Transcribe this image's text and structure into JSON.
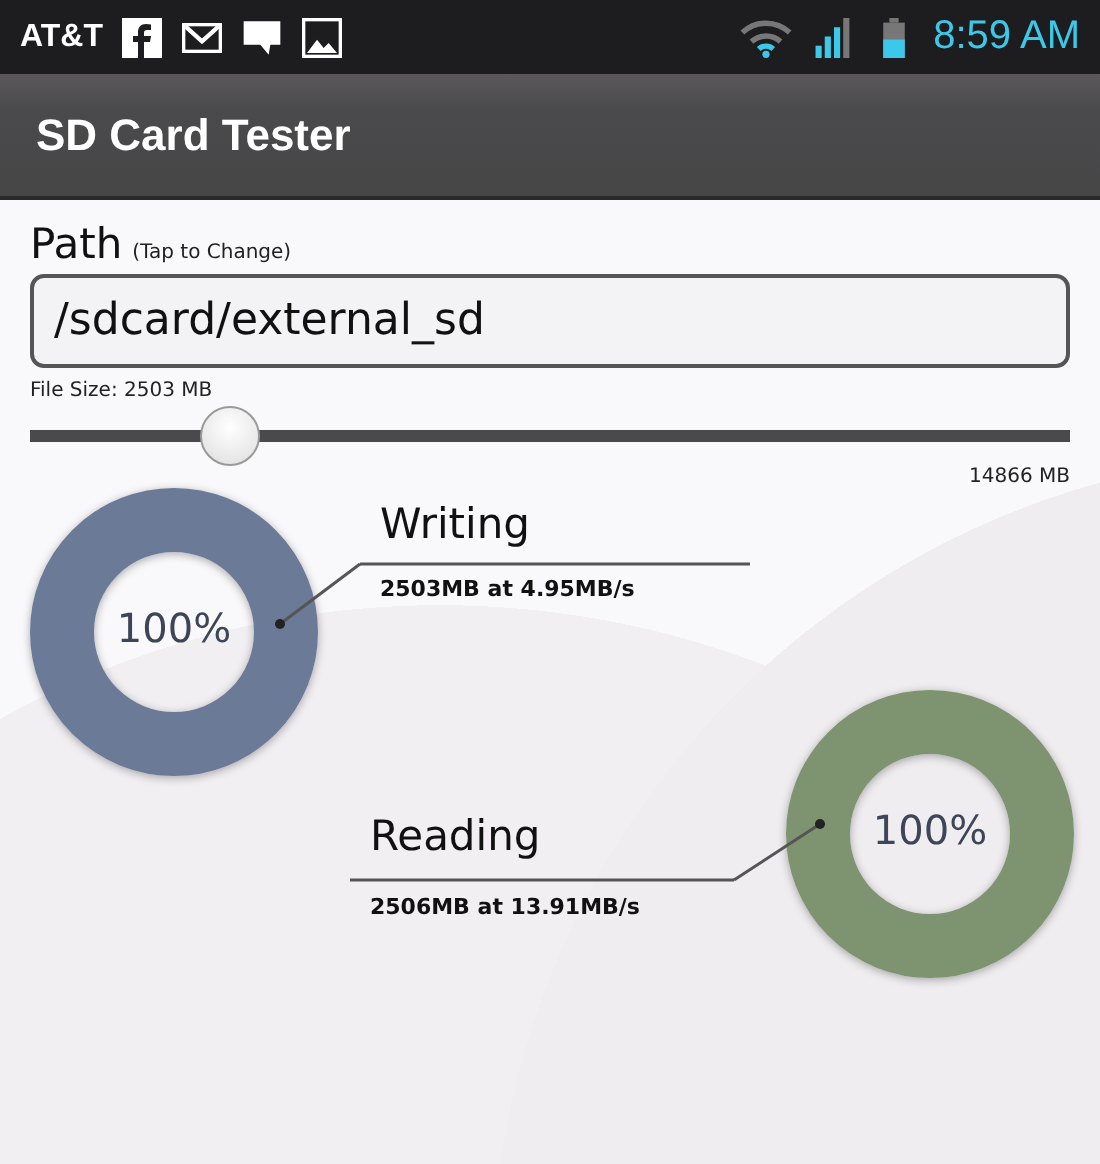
{
  "status_bar": {
    "carrier": "AT&T",
    "time": "8:59 AM"
  },
  "app_bar": {
    "title": "SD Card Tester"
  },
  "path": {
    "label": "Path",
    "hint": "(Tap to Change)",
    "value": "/sdcard/external_sd"
  },
  "file_size": {
    "label": "File Size: 2503 MB",
    "level": 0.19,
    "max_label": "14866 MB"
  },
  "results": [
    {
      "kind": "writing",
      "title": "Writing",
      "detail": "2503MB at 4.95MB/s",
      "percent": "100%",
      "level": 1,
      "color": "#6b7a96"
    },
    {
      "kind": "reading",
      "title": "Reading",
      "detail": "2506MB at 13.91MB/s",
      "percent": "100%",
      "level": 1,
      "color": "#7e9470"
    }
  ]
}
